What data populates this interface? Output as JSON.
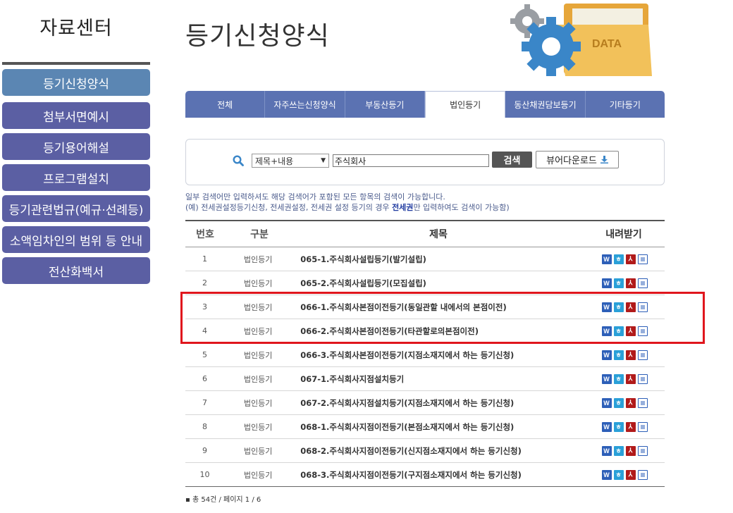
{
  "sidebar": {
    "title": "자료센터",
    "items": [
      {
        "label": "등기신청양식",
        "active": true
      },
      {
        "label": "첨부서면예시"
      },
      {
        "label": "등기용어해설"
      },
      {
        "label": "프로그램설치"
      },
      {
        "label": "등기관련법규(예규·선례등)"
      },
      {
        "label": "소액임차인의 범위 등 안내"
      },
      {
        "label": "전산화백서"
      }
    ]
  },
  "header": {
    "title": "등기신청양식",
    "hero_text": "DATA"
  },
  "tabs": [
    "전체",
    "자주쓰는신청양식",
    "부동산등기",
    "법인등기",
    "동산채권담보등기",
    "기타등기"
  ],
  "active_tab": "법인등기",
  "search": {
    "select_value": "제목+내용",
    "input_value": "주식회사",
    "search_label": "검색",
    "viewer_label": "뷰어다운로드"
  },
  "notice": {
    "line1": "일부 검색어만 입력하셔도 해당 검색어가 포함된 모든 항목의 검색이 가능합니다.",
    "line2_pre": "(예) 전세권설정등기신청, 전세권설정, 전세권 설정 등기의 경우 ",
    "line2_bold": "전세권",
    "line2_post": "만 입력하여도 검색이 가능함)"
  },
  "table": {
    "headers": {
      "no": "번호",
      "category": "구분",
      "title": "제목",
      "download": "내려받기"
    },
    "rows": [
      {
        "no": "1",
        "category": "법인등기",
        "title": "065-1.주식회사설립등기(발기설립)"
      },
      {
        "no": "2",
        "category": "법인등기",
        "title": "065-2.주식회사설립등기(모집설립)"
      },
      {
        "no": "3",
        "category": "법인등기",
        "title": "066-1.주식회사본점이전등기(동일관할 내에서의 본점이전)"
      },
      {
        "no": "4",
        "category": "법인등기",
        "title": "066-2.주식회사본점이전등기(타관할로의본점이전)"
      },
      {
        "no": "5",
        "category": "법인등기",
        "title": "066-3.주식회사본점이전등기(지점소재지에서 하는 등기신청)"
      },
      {
        "no": "6",
        "category": "법인등기",
        "title": "067-1.주식회사지점설치등기"
      },
      {
        "no": "7",
        "category": "법인등기",
        "title": "067-2.주식회사지점설치등기(지점소재지에서 하는 등기신청)"
      },
      {
        "no": "8",
        "category": "법인등기",
        "title": "068-1.주식회사지점이전등기(본점소재지에서 하는 등기신청)"
      },
      {
        "no": "9",
        "category": "법인등기",
        "title": "068-2.주식회사지점이전등기(신지점소재지에서 하는 등기신청)"
      },
      {
        "no": "10",
        "category": "법인등기",
        "title": "068-3.주식회사지점이전등기(구지점소재지에서 하는 등기신청)"
      }
    ],
    "download_icons": [
      "word-icon",
      "hwp-icon",
      "pdf-icon",
      "text-file-icon"
    ]
  },
  "footer": {
    "summary": "총 54건 / 페이지 1 / 6"
  }
}
